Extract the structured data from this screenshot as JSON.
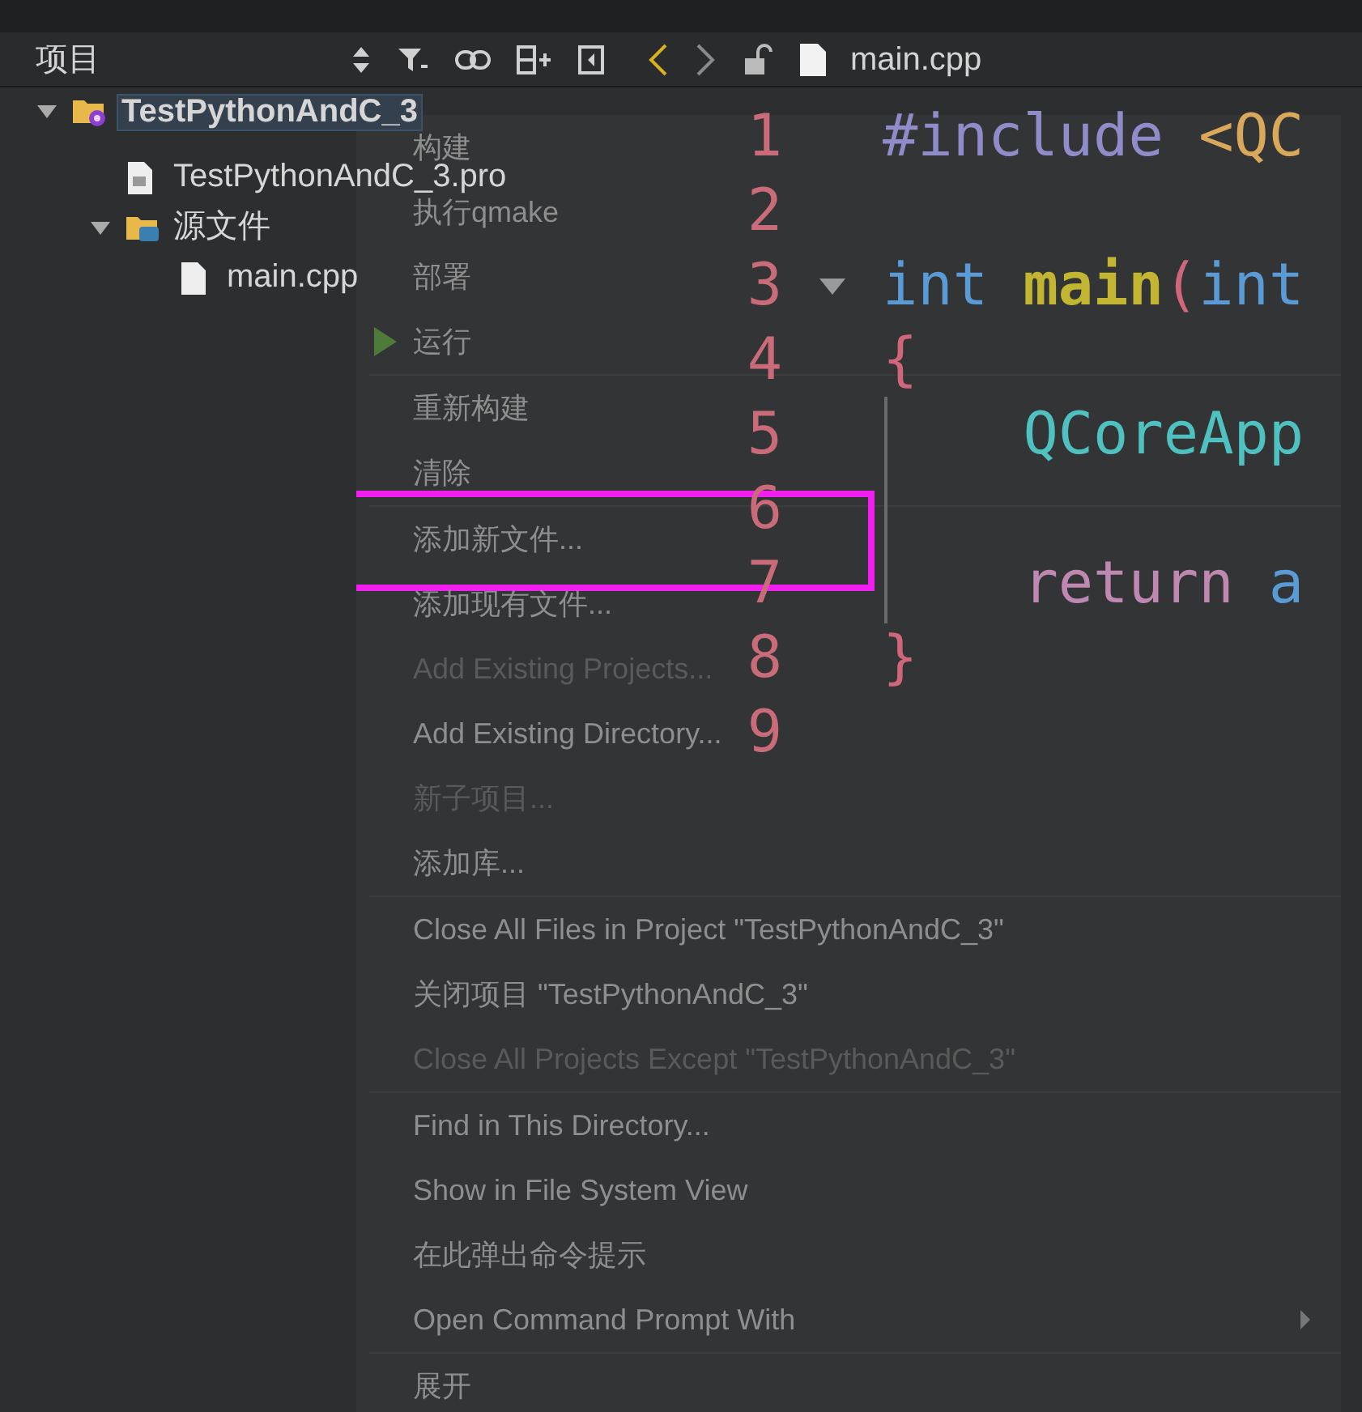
{
  "panel": {
    "title": "项目"
  },
  "editor_toolbar": {
    "file": "main.cpp"
  },
  "tree": [
    {
      "label": "TestPythonAndC_3",
      "kind": "project",
      "selected": true,
      "expanded": true,
      "children": [
        {
          "label": "TestPythonAndC_3.pro",
          "kind": "pro",
          "selected": false
        },
        {
          "label": "源文件",
          "kind": "folder",
          "selected": false,
          "expanded": true,
          "children": [
            {
              "label": "main.cpp",
              "kind": "file",
              "selected": false
            }
          ]
        }
      ]
    }
  ],
  "editor": {
    "lines": [
      {
        "number": "1",
        "tokens": [
          {
            "text": "#include ",
            "kind": "preproc"
          },
          {
            "text": "<QC",
            "kind": "string"
          }
        ]
      },
      {
        "number": "2"
      },
      {
        "number": "3",
        "foldable": true,
        "tokens": [
          {
            "text": "int ",
            "kind": "keyword"
          },
          {
            "text": "main",
            "kind": "function"
          },
          {
            "text": "(",
            "kind": "punct"
          },
          {
            "text": "int",
            "kind": "keyword"
          }
        ]
      },
      {
        "number": "4",
        "tokens": [
          {
            "text": "{",
            "kind": "punct"
          }
        ]
      },
      {
        "number": "5",
        "tokens": [
          {
            "text": "    QCoreApp",
            "kind": "type"
          }
        ]
      },
      {
        "number": "6"
      },
      {
        "number": "7",
        "tokens": [
          {
            "text": "    return ",
            "kind": "control"
          },
          {
            "text": "a",
            "kind": "keyword"
          }
        ]
      },
      {
        "number": "8",
        "tokens": [
          {
            "text": "}",
            "kind": "punct"
          }
        ]
      },
      {
        "number": "9"
      }
    ]
  },
  "context_menu": {
    "items": [
      {
        "kind": "item",
        "label": "构建",
        "disabled": false
      },
      {
        "kind": "item",
        "label": "执行qmake",
        "disabled": false
      },
      {
        "kind": "item",
        "label": "部署",
        "disabled": false
      },
      {
        "kind": "run",
        "label": "运行",
        "disabled": false
      },
      {
        "kind": "separator"
      },
      {
        "kind": "item",
        "label": "重新构建",
        "disabled": false
      },
      {
        "kind": "item",
        "label": "清除",
        "disabled": false
      },
      {
        "kind": "separator"
      },
      {
        "kind": "item",
        "label": "添加新文件...",
        "disabled": false,
        "annotated": true
      },
      {
        "kind": "item",
        "label": "添加现有文件...",
        "disabled": false
      },
      {
        "kind": "item",
        "label": "Add Existing Projects...",
        "disabled": true
      },
      {
        "kind": "item",
        "label": "Add Existing Directory...",
        "disabled": false
      },
      {
        "kind": "item",
        "label": "新子项目...",
        "disabled": true
      },
      {
        "kind": "item",
        "label": "添加库...",
        "disabled": false
      },
      {
        "kind": "separator"
      },
      {
        "kind": "item",
        "label": "Close All Files in Project \"TestPythonAndC_3\"",
        "disabled": false
      },
      {
        "kind": "item",
        "label": "关闭项目 \"TestPythonAndC_3\"",
        "disabled": false
      },
      {
        "kind": "item",
        "label": "Close All Projects Except \"TestPythonAndC_3\"",
        "disabled": true
      },
      {
        "kind": "separator"
      },
      {
        "kind": "item",
        "label": "Find in This Directory...",
        "disabled": false
      },
      {
        "kind": "item",
        "label": "Show in File System View",
        "disabled": false
      },
      {
        "kind": "item",
        "label": "在此弹出命令提示",
        "disabled": false
      },
      {
        "kind": "item",
        "label": "Open Command Prompt With",
        "disabled": false,
        "submenu": true
      },
      {
        "kind": "separator"
      },
      {
        "kind": "item",
        "label": "展开",
        "disabled": false
      }
    ]
  }
}
